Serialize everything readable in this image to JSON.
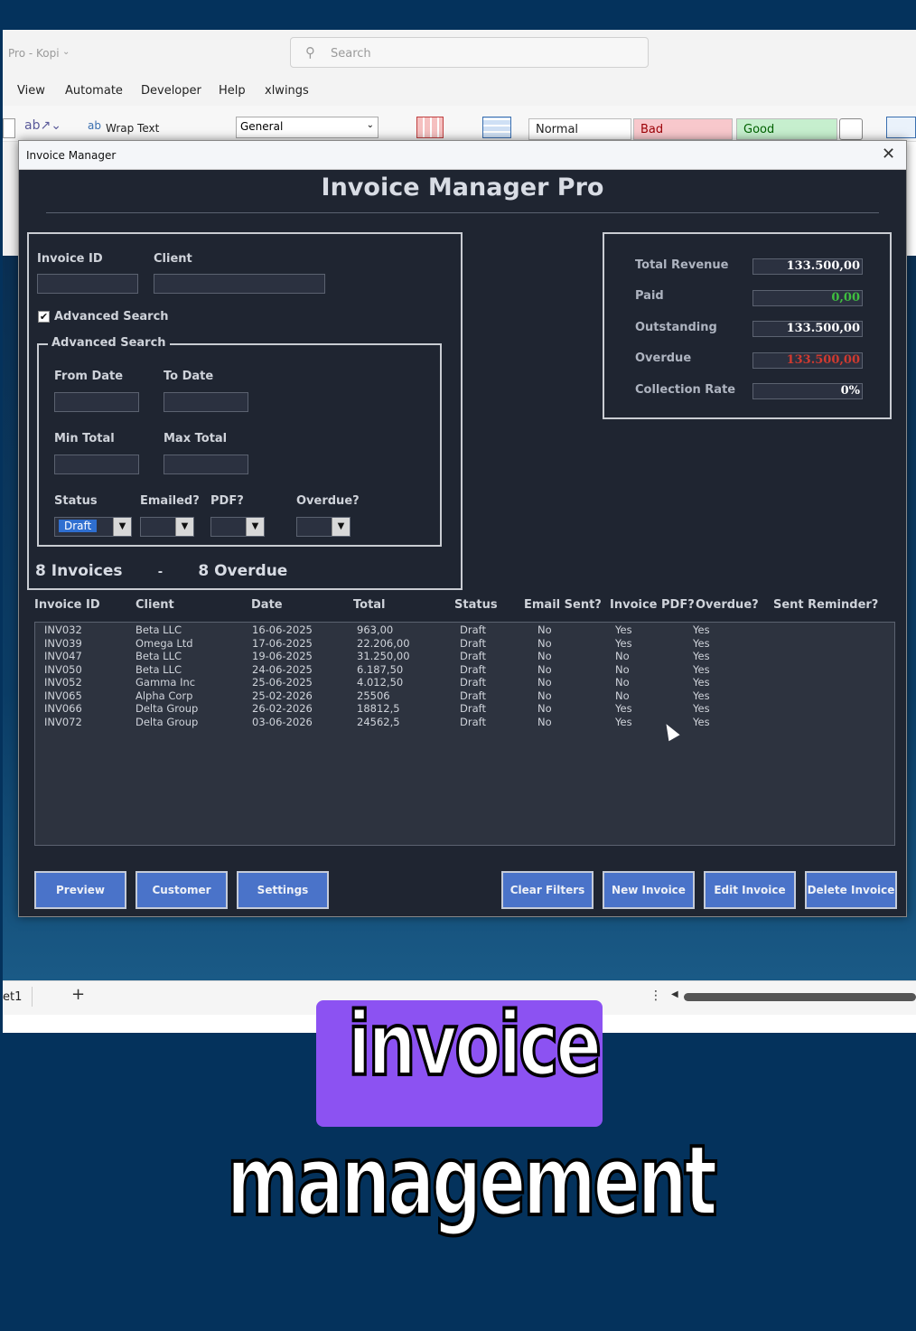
{
  "excel": {
    "window_title": "Pro - Kopi",
    "search_placeholder": "Search",
    "menu": [
      "View",
      "Automate",
      "Developer",
      "Help",
      "xlwings"
    ],
    "ribbon": {
      "wrap_text": "Wrap Text",
      "number_format": "General",
      "style_normal": "Normal",
      "style_bad": "Bad",
      "style_good": "Good"
    },
    "sheet_tab": "et1",
    "add_sheet": "+"
  },
  "dialog": {
    "window_title": "Invoice Manager",
    "close_glyph": "✕",
    "app_title": "Invoice Manager Pro",
    "filters": {
      "invoice_id_label": "Invoice ID",
      "client_label": "Client",
      "advanced_search_checkbox": "Advanced Search",
      "advanced_search_checked": true,
      "advanced_group_title": "Advanced Search",
      "from_date_label": "From Date",
      "to_date_label": "To Date",
      "min_total_label": "Min Total",
      "max_total_label": "Max Total",
      "status_label": "Status",
      "status_value": "Draft",
      "emailed_label": "Emailed?",
      "pdf_label": "PDF?",
      "overdue_label": "Overdue?"
    },
    "counts": {
      "invoices": "8 Invoices",
      "separator": "-",
      "overdue": "8 Overdue"
    },
    "summary": [
      {
        "label": "Total Revenue",
        "value": "133.500,00",
        "color": "#ffffff"
      },
      {
        "label": "Paid",
        "value": "0,00",
        "color": "#3fbf3f"
      },
      {
        "label": "Outstanding",
        "value": "133.500,00",
        "color": "#ffffff"
      },
      {
        "label": "Overdue",
        "value": "133.500,00",
        "color": "#d03a2f"
      },
      {
        "label": "Collection Rate",
        "value": "0%",
        "color": "#ffffff"
      }
    ],
    "table": {
      "headers": [
        "Invoice ID",
        "Client",
        "Date",
        "Total",
        "Status",
        "Email Sent?",
        "Invoice PDF?",
        "Overdue?",
        "Sent Reminder?"
      ],
      "rows": [
        [
          "INV032",
          "Beta LLC",
          "16-06-2025",
          "963,00",
          "Draft",
          "No",
          "Yes",
          "Yes"
        ],
        [
          "INV039",
          "Omega Ltd",
          "17-06-2025",
          "22.206,00",
          "Draft",
          "No",
          "Yes",
          "Yes"
        ],
        [
          "INV047",
          "Beta LLC",
          "19-06-2025",
          "31.250,00",
          "Draft",
          "No",
          "No",
          "Yes"
        ],
        [
          "INV050",
          "Beta LLC",
          "24-06-2025",
          "6.187,50",
          "Draft",
          "No",
          "No",
          "Yes"
        ],
        [
          "INV052",
          "Gamma Inc",
          "25-06-2025",
          "4.012,50",
          "Draft",
          "No",
          "No",
          "Yes"
        ],
        [
          "INV065",
          "Alpha Corp",
          "25-02-2026",
          "25506",
          "Draft",
          "No",
          "No",
          "Yes"
        ],
        [
          "INV066",
          "Delta Group",
          "26-02-2026",
          "18812,5",
          "Draft",
          "No",
          "Yes",
          "Yes"
        ],
        [
          "INV072",
          "Delta Group",
          "03-06-2026",
          "24562,5",
          "Draft",
          "No",
          "Yes",
          "Yes"
        ]
      ]
    },
    "buttons": {
      "preview": "Preview",
      "customer": "Customer",
      "settings": "Settings",
      "clear_filters": "Clear Filters",
      "new_invoice": "New Invoice",
      "edit_invoice": "Edit Invoice",
      "delete_invoice": "Delete Invoice"
    }
  },
  "captions": {
    "line1": "invoice",
    "line2": "management",
    "highlight_color": "#8c52f2"
  }
}
